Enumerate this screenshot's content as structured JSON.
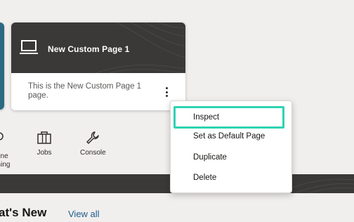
{
  "card": {
    "title": "New Custom Page 1",
    "description": "This is the New Custom Page 1 page."
  },
  "nav": {
    "partial_label": "ine ning",
    "items": [
      {
        "label": "Jobs",
        "icon": "briefcase-icon"
      },
      {
        "label": "Console",
        "icon": "wrench-icon"
      }
    ]
  },
  "context_menu": {
    "items": [
      {
        "label": "Inspect",
        "focused": true
      },
      {
        "label": "Set as Default Page"
      },
      {
        "label": "Duplicate"
      },
      {
        "label": "Delete"
      }
    ]
  },
  "section": {
    "title": "at's New",
    "view_all": "View all"
  },
  "colors": {
    "card_header": "#3a3937",
    "focus_ring": "#2ed3b2",
    "link": "#1c5d8f",
    "left_card_accent": "#2c6a82"
  }
}
